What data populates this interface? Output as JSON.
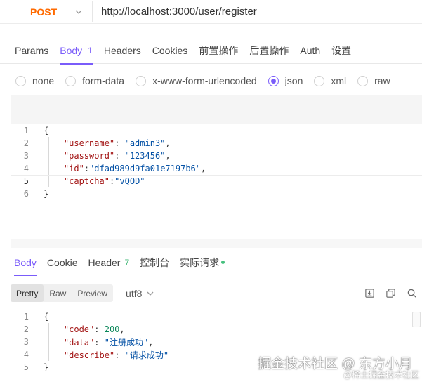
{
  "request": {
    "method": "POST",
    "url": "http://localhost:3000/user/register"
  },
  "request_tabs": [
    {
      "label": "Params"
    },
    {
      "label": "Body",
      "badge": "1"
    },
    {
      "label": "Headers"
    },
    {
      "label": "Cookies"
    },
    {
      "label": "前置操作"
    },
    {
      "label": "后置操作"
    },
    {
      "label": "Auth"
    },
    {
      "label": "设置"
    }
  ],
  "body_types": {
    "none": "none",
    "form_data": "form-data",
    "urlencoded": "x-www-form-urlencoded",
    "json": "json",
    "xml": "xml",
    "raw": "raw",
    "selected": "json"
  },
  "request_body": {
    "line_numbers": [
      "1",
      "2",
      "3",
      "4",
      "5",
      "6"
    ],
    "open": "{",
    "close": "}",
    "fields": [
      {
        "key": "\"username\"",
        "value": "\"admin3\"",
        "sep": ": ",
        "tail": ","
      },
      {
        "key": "\"password\"",
        "value": "\"123456\"",
        "sep": ": ",
        "tail": ","
      },
      {
        "key": "\"id\"",
        "value": "\"dfad989d9fa01e7197b6\"",
        "sep": ":",
        "tail": ","
      },
      {
        "key": "\"captcha\"",
        "value": "\"vQOD\"",
        "sep": ":",
        "tail": ""
      }
    ]
  },
  "response_tabs": {
    "body": "Body",
    "cookie": "Cookie",
    "header": "Header",
    "header_count": "7",
    "console": "控制台",
    "actual_request": "实际请求"
  },
  "response_toolbar": {
    "pretty": "Pretty",
    "raw": "Raw",
    "preview": "Preview",
    "encoding": "utf8"
  },
  "response_body": {
    "line_numbers": [
      "1",
      "2",
      "3",
      "4",
      "5"
    ],
    "open": "{",
    "close": "}",
    "fields": [
      {
        "key": "\"code\"",
        "value": "200",
        "tail": ","
      },
      {
        "key": "\"data\"",
        "value": "\"注册成功\"",
        "tail": ","
      },
      {
        "key": "\"describe\"",
        "value": "\"请求成功\"",
        "tail": ""
      }
    ]
  },
  "watermark": {
    "main": "掘金技术社区 @ 东方小月",
    "sub": "@稀土掘金技术社区"
  },
  "colors": {
    "accent": "#7a5cfa",
    "method_post": "#ff6a00",
    "status_dot": "#46c07e"
  }
}
